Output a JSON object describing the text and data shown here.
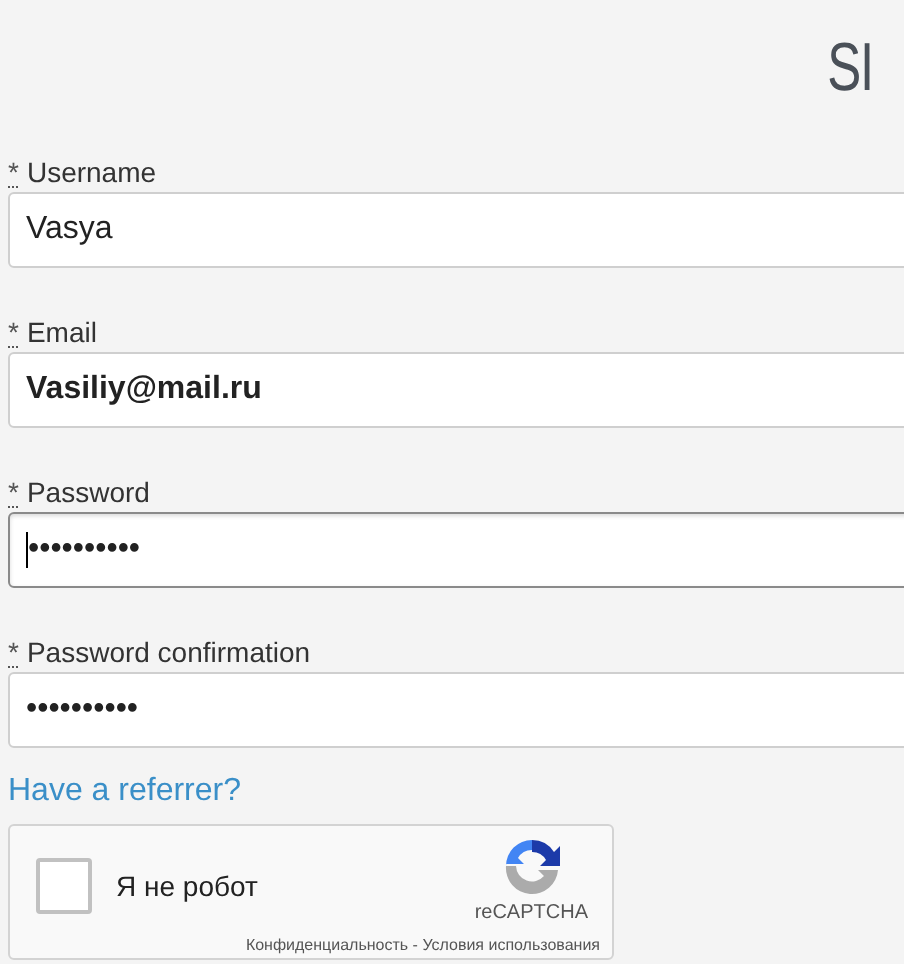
{
  "heading": "SI",
  "fields": [
    {
      "label": "Username",
      "required_mark": "*",
      "value": "Vasya",
      "focused": false,
      "autofilled": false
    },
    {
      "label": "Email",
      "required_mark": "*",
      "value": "Vasiliy@mail.ru",
      "focused": false,
      "autofilled": true
    },
    {
      "label": "Password",
      "required_mark": "*",
      "value": "••••••••••",
      "focused": true,
      "autofilled": false
    },
    {
      "label": "Password confirmation",
      "required_mark": "*",
      "value": "••••••••••",
      "focused": false,
      "autofilled": false
    }
  ],
  "referrer_link": "Have a referrer?",
  "captcha": {
    "checked": false,
    "label": "Я не робот",
    "brand": "reCAPTCHA",
    "footer": "Конфиденциальность - Условия использования"
  }
}
